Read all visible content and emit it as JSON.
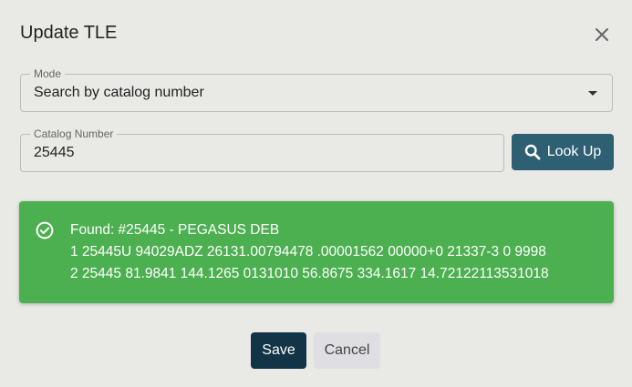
{
  "dialog": {
    "title": "Update TLE",
    "close_icon": "close-icon"
  },
  "mode": {
    "label": "Mode",
    "value": "Search by catalog number",
    "icon": "chevron-down-icon"
  },
  "catalog": {
    "label": "Catalog Number",
    "value": "25445"
  },
  "lookup": {
    "label": "Look Up",
    "icon": "search-icon"
  },
  "result": {
    "icon": "check-circle-icon",
    "lines": [
      "Found: #25445 - PEGASUS DEB",
      "1 25445U 94029ADZ 26131.00794478 .00001562 00000+0 21337-3 0 9998",
      "2 25445 81.9841 144.1265 0131010 56.8675 334.1617 14.72122113531018"
    ]
  },
  "actions": {
    "save_label": "Save",
    "cancel_label": "Cancel"
  },
  "colors": {
    "background": "#e9e9e5",
    "lookup_button": "#2f5f73",
    "success": "#4caf50",
    "save_button": "#133346",
    "cancel_button": "#dfdfe3"
  }
}
